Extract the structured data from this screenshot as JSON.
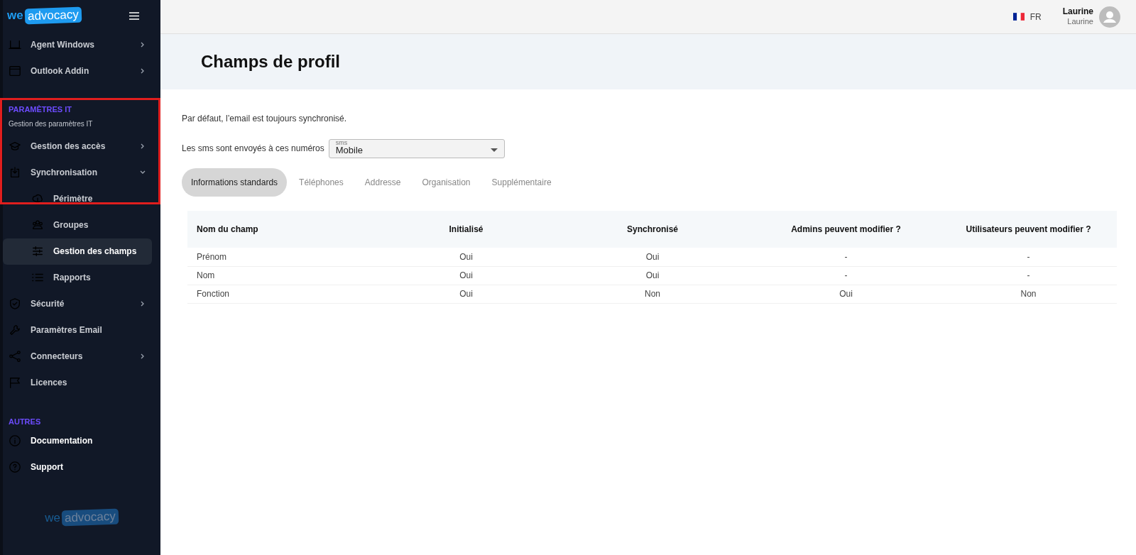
{
  "logo": {
    "prefix": "we",
    "word": "advocacy"
  },
  "footer_logo": {
    "prefix": "we",
    "word": "advocacy"
  },
  "sidebar": {
    "sections": [
      {
        "kind": "nav",
        "items": [
          {
            "label": "Agent Windows",
            "expanded": false,
            "selected": false
          },
          {
            "label": "Outlook Addin",
            "expanded": false,
            "selected": false
          }
        ]
      },
      {
        "kind": "nav",
        "title": "PARAMÈTRES IT",
        "subtitle": "Gestion des paramètres IT",
        "highlighted": true,
        "items": [
          {
            "label": "Gestion des accès",
            "expanded": false,
            "selected": false
          },
          {
            "label": "Synchronisation",
            "expanded": true,
            "selected": false,
            "children": [
              {
                "label": "Périmètre",
                "selected": false
              },
              {
                "label": "Groupes",
                "selected": false
              },
              {
                "label": "Gestion des champs",
                "selected": true
              },
              {
                "label": "Rapports",
                "selected": false
              }
            ]
          },
          {
            "label": "Sécurité",
            "expanded": false,
            "selected": false
          },
          {
            "label": "Paramètres Email",
            "selected": false
          },
          {
            "label": "Connecteurs",
            "expanded": false,
            "selected": false
          },
          {
            "label": "Licences",
            "selected": false
          }
        ]
      },
      {
        "kind": "links",
        "title": "AUTRES",
        "items": [
          {
            "label": "Documentation",
            "selected": false
          },
          {
            "label": "Support",
            "selected": false
          }
        ]
      }
    ]
  },
  "topbar": {
    "language": "FR",
    "user_name": "Laurine",
    "user_subtitle": "Laurine"
  },
  "page_title": "Champs de profil",
  "note": "Par défaut, l’email est toujours synchronisé.",
  "sms": {
    "label": "Les sms sont envoyés à ces numéros",
    "field_label": "sms",
    "value": "Mobile"
  },
  "tabs": [
    {
      "label": "Informations standards",
      "selected": true
    },
    {
      "label": "Téléphones",
      "selected": false
    },
    {
      "label": "Addresse",
      "selected": false
    },
    {
      "label": "Organisation",
      "selected": false
    },
    {
      "label": "Supplémentaire",
      "selected": false
    }
  ],
  "table": {
    "columns": [
      "Nom du champ",
      "Initialisé",
      "Synchronisé",
      "Admins peuvent modifier ?",
      "Utilisateurs peuvent modifier ?"
    ],
    "rows": [
      [
        "Prénom",
        "Oui",
        "Oui",
        "-",
        "-"
      ],
      [
        "Nom",
        "Oui",
        "Oui",
        "-",
        "-"
      ],
      [
        "Fonction",
        "Oui",
        "Non",
        "Oui",
        "Non"
      ]
    ]
  }
}
